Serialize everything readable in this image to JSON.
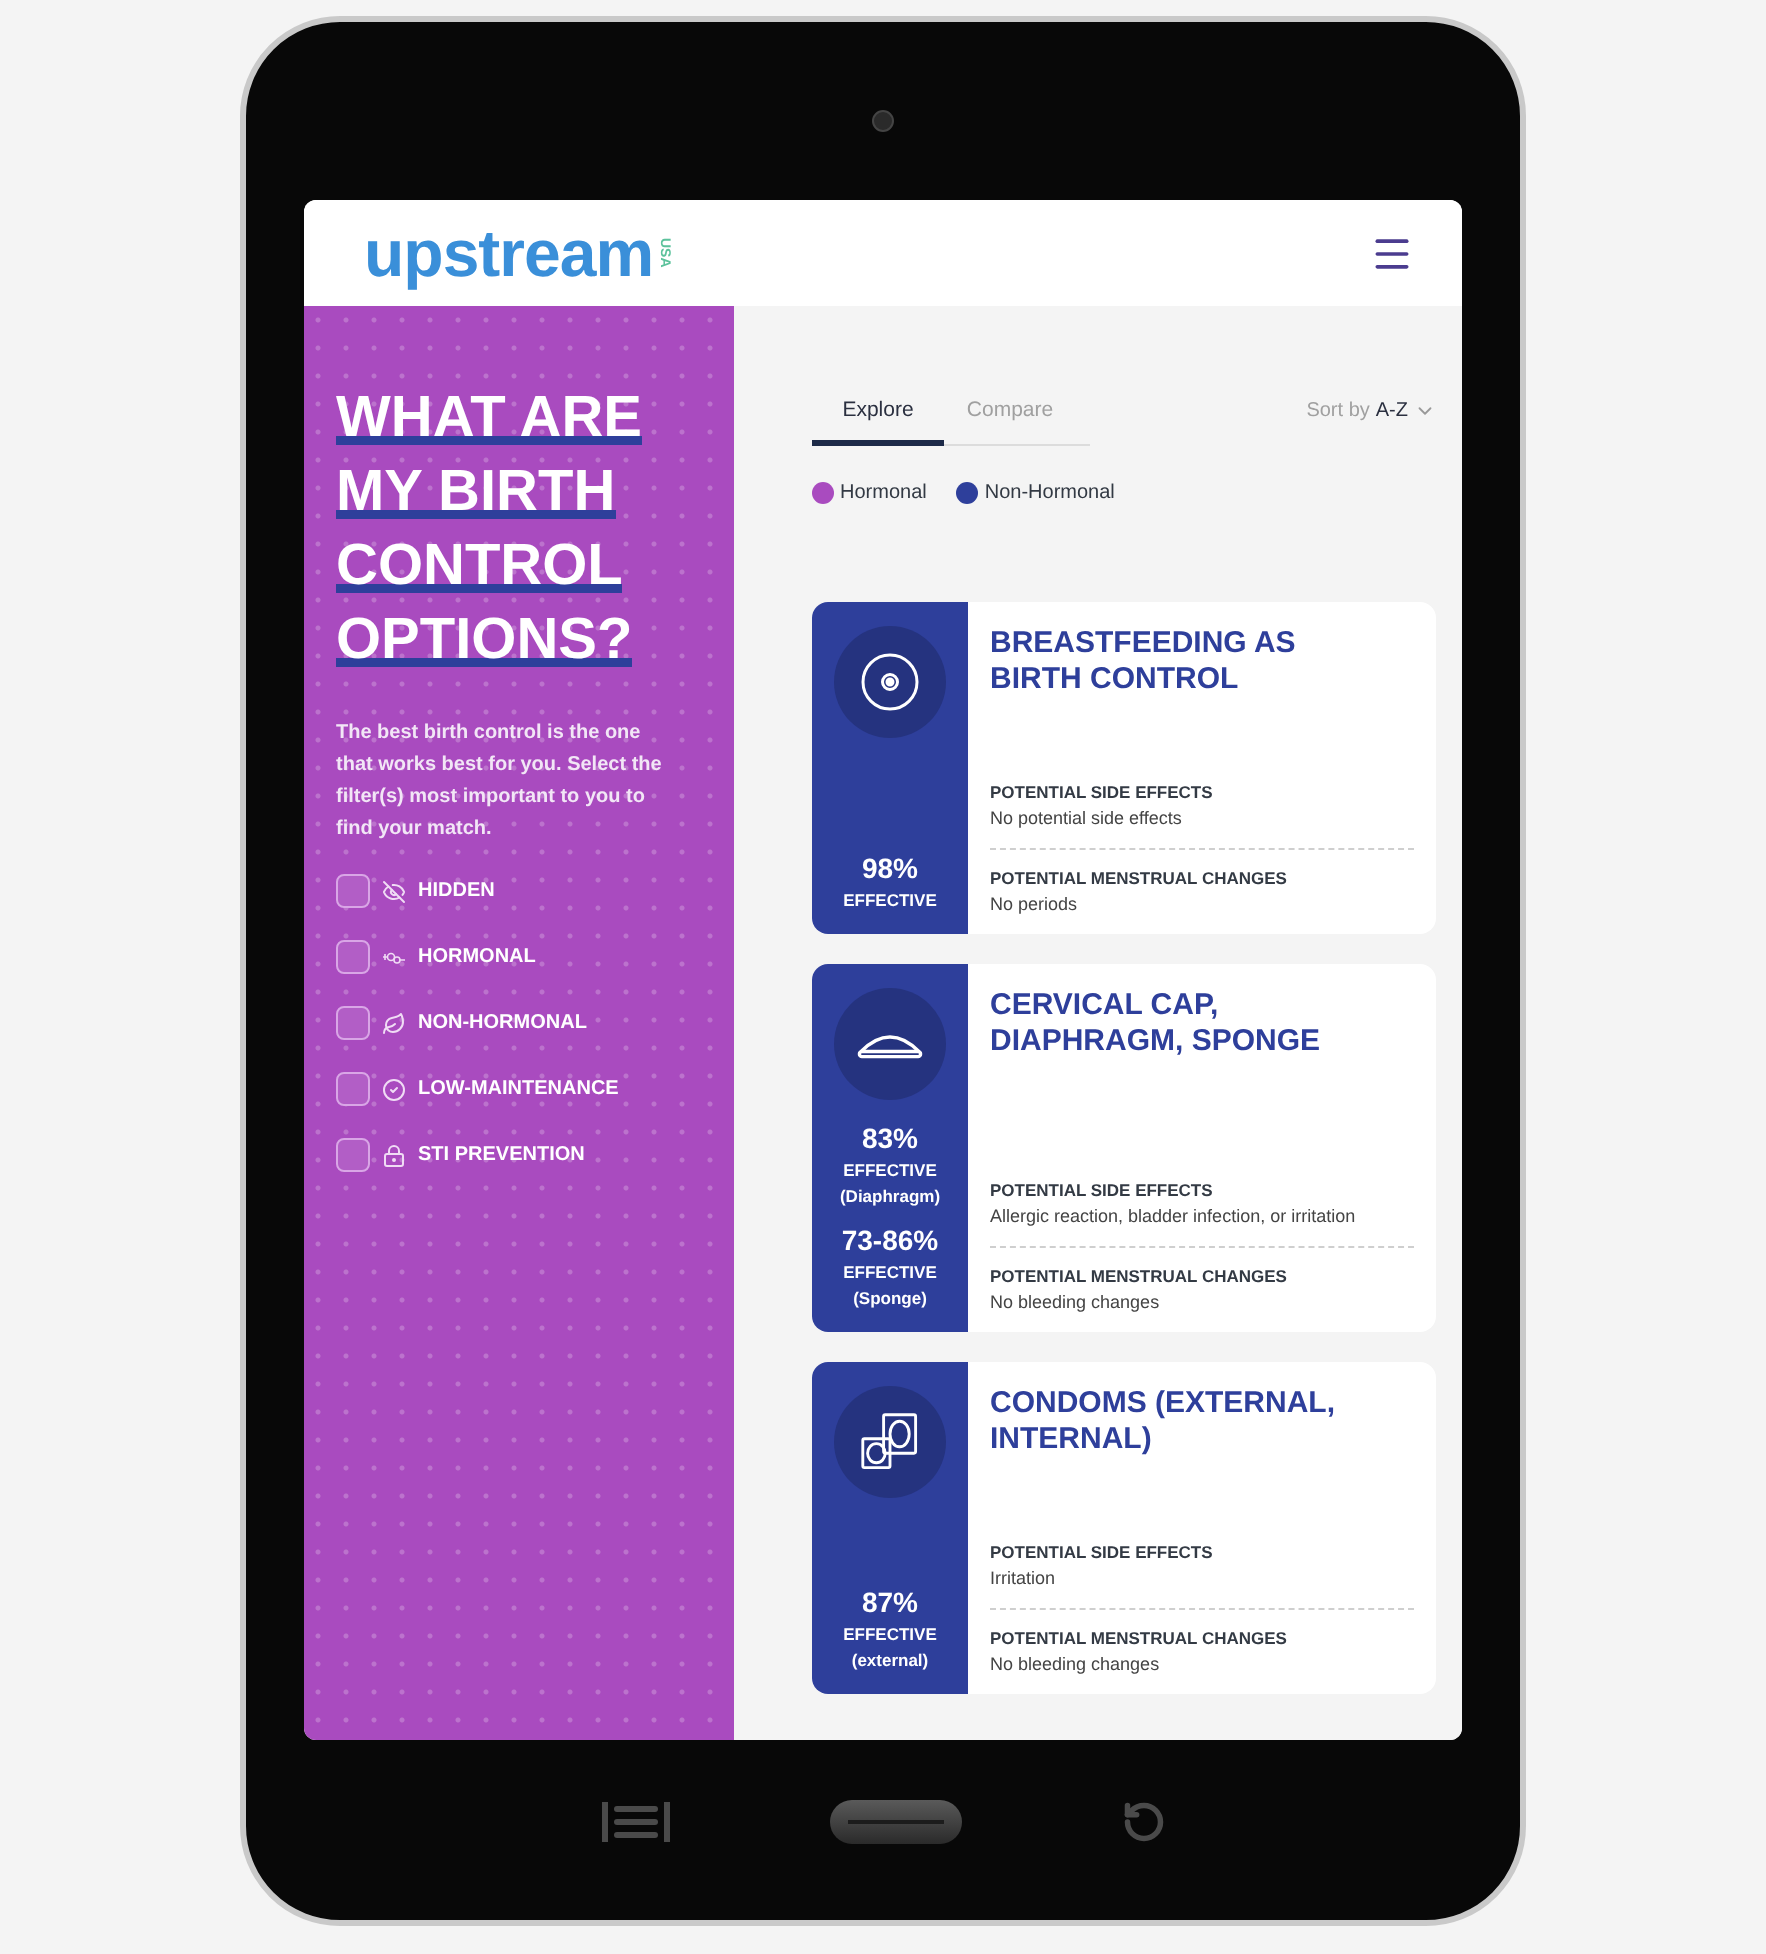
{
  "header": {
    "logo": "upstream",
    "logo_suffix": "USA"
  },
  "sidebar": {
    "heading": "WHAT ARE MY BIRTH CONTROL OPTIONS?",
    "intro": "The best birth control is the one that works best for you. Select the filter(s) most important to you to find your match.",
    "filters": [
      {
        "label": "HIDDEN",
        "checked": false
      },
      {
        "label": "HORMONAL",
        "checked": false
      },
      {
        "label": "NON-HORMONAL",
        "checked": false
      },
      {
        "label": "LOW-MAINTENANCE",
        "checked": false
      },
      {
        "label": "STI PREVENTION",
        "checked": false
      }
    ]
  },
  "tabs": [
    {
      "label": "Explore",
      "selected": true
    },
    {
      "label": "Compare",
      "selected": false
    }
  ],
  "sort": {
    "label": "Sort by",
    "value": "A-Z"
  },
  "legend": [
    {
      "label": "Hormonal",
      "color": "#a94bbf"
    },
    {
      "label": "Non-Hormonal",
      "color": "#2e3f9b"
    }
  ],
  "cards": [
    {
      "title": "BREASTFEEDING AS BIRTH CONTROL",
      "color": "#2e3f9b",
      "effectiveness": [
        {
          "value": "98%",
          "label": "EFFECTIVE"
        }
      ],
      "side_effects_label": "POTENTIAL SIDE EFFECTS",
      "side_effects": "No potential side effects",
      "menstrual_label": "POTENTIAL MENSTRUAL CHANGES",
      "menstrual": "No periods"
    },
    {
      "title": "CERVICAL CAP, DIAPHRAGM, SPONGE",
      "color": "#2e3f9b",
      "effectiveness": [
        {
          "value": "83%",
          "label": "EFFECTIVE",
          "note": "(Diaphragm)"
        },
        {
          "value": "73-86%",
          "label": "EFFECTIVE",
          "note": "(Sponge)"
        }
      ],
      "side_effects_label": "POTENTIAL SIDE EFFECTS",
      "side_effects": "Allergic reaction, bladder infection, or irritation",
      "menstrual_label": "POTENTIAL MENSTRUAL CHANGES",
      "menstrual": "No bleeding changes"
    },
    {
      "title": "CONDOMS (EXTERNAL, INTERNAL)",
      "color": "#2e3f9b",
      "effectiveness": [
        {
          "value": "87%",
          "label": "EFFECTIVE",
          "note": "(external)"
        }
      ],
      "side_effects_label": "POTENTIAL SIDE EFFECTS",
      "side_effects": "Irritation",
      "menstrual_label": "POTENTIAL MENSTRUAL CHANGES",
      "menstrual": "No bleeding changes"
    }
  ]
}
